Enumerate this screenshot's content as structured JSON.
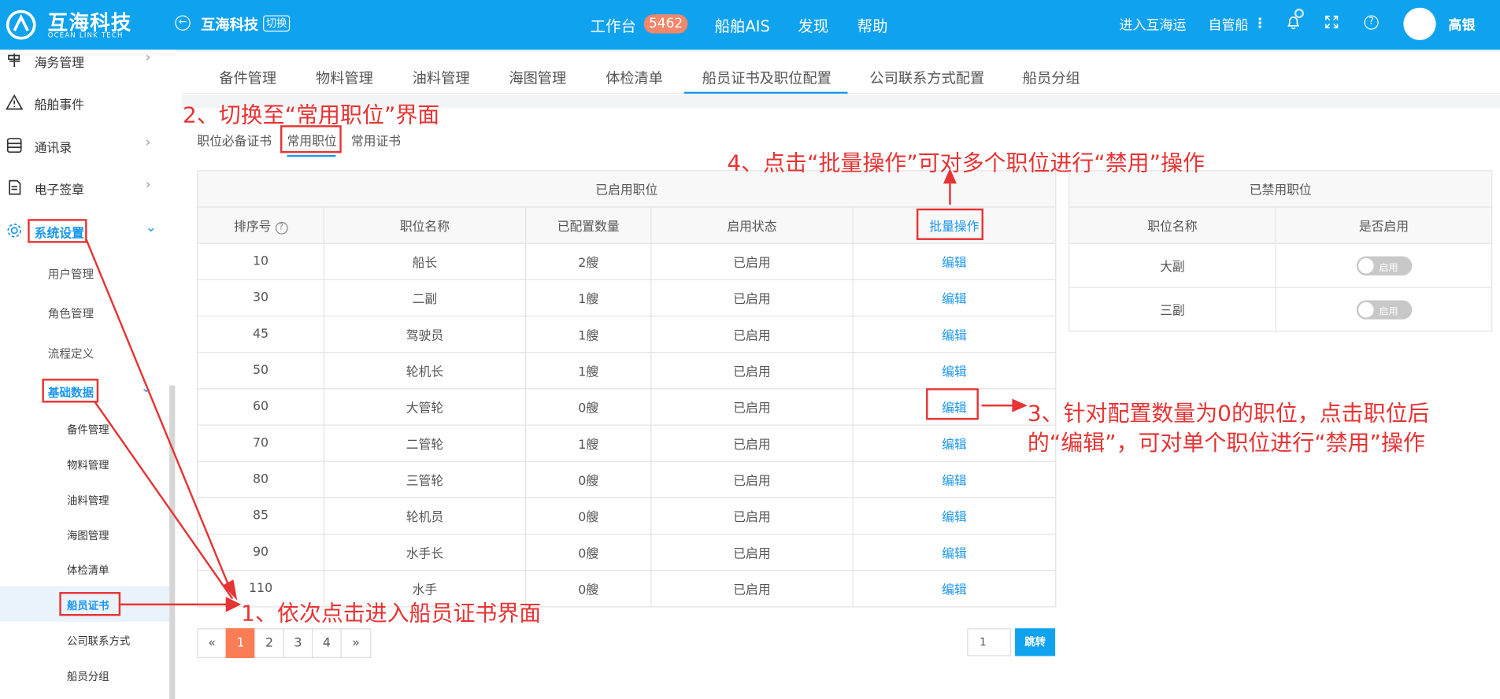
{
  "header": {
    "logo_cn": "互海科技",
    "logo_en": "OCEAN LINK TECH",
    "company": "互海科技",
    "switch_label": "切换",
    "nav": [
      "工作台",
      "船舶AIS",
      "发现",
      "帮助"
    ],
    "badge": "5462",
    "right_nav": [
      "进入互海运",
      "自管船"
    ],
    "user": "高银"
  },
  "sidebar": {
    "top_items": [
      "海务管理",
      "船舶事件",
      "通讯录",
      "电子签章",
      "系统设置"
    ],
    "settings_children": [
      "用户管理",
      "角色管理",
      "流程定义",
      "基础数据"
    ],
    "basic_children": [
      "备件管理",
      "物料管理",
      "油料管理",
      "海图管理",
      "体检清单",
      "船员证书",
      "公司联系方式",
      "船员分组"
    ]
  },
  "tabs": [
    "备件管理",
    "物料管理",
    "油料管理",
    "海图管理",
    "体检清单",
    "船员证书及职位配置",
    "公司联系方式配置",
    "船员分组"
  ],
  "subtabs": [
    "职位必备证书",
    "常用职位",
    "常用证书"
  ],
  "enabled_table": {
    "caption": "已启用职位",
    "headers": [
      "排序号",
      "职位名称",
      "已配置数量",
      "启用状态",
      "批量操作"
    ],
    "rows": [
      [
        "10",
        "船长",
        "2艘",
        "已启用",
        "编辑"
      ],
      [
        "30",
        "二副",
        "1艘",
        "已启用",
        "编辑"
      ],
      [
        "45",
        "驾驶员",
        "1艘",
        "已启用",
        "编辑"
      ],
      [
        "50",
        "轮机长",
        "1艘",
        "已启用",
        "编辑"
      ],
      [
        "60",
        "大管轮",
        "0艘",
        "已启用",
        "编辑"
      ],
      [
        "70",
        "二管轮",
        "1艘",
        "已启用",
        "编辑"
      ],
      [
        "80",
        "三管轮",
        "0艘",
        "已启用",
        "编辑"
      ],
      [
        "85",
        "轮机员",
        "0艘",
        "已启用",
        "编辑"
      ],
      [
        "90",
        "水手长",
        "0艘",
        "已启用",
        "编辑"
      ],
      [
        "110",
        "水手",
        "0艘",
        "已启用",
        "编辑"
      ]
    ]
  },
  "disabled_table": {
    "caption": "已禁用职位",
    "headers": [
      "职位名称",
      "是否启用"
    ],
    "rows": [
      {
        "name": "大副",
        "toggle": "启用"
      },
      {
        "name": "三副",
        "toggle": "启用"
      }
    ]
  },
  "pagination": {
    "prev": "«",
    "pages": [
      "1",
      "2",
      "3",
      "4"
    ],
    "current": "1",
    "next": "»",
    "jump_value": "1",
    "jump_label": "跳转"
  },
  "annotations": {
    "step1": "1、依次点击进入船员证书界面",
    "step2": "2、切换至“常用职位”界面",
    "step3_line1": "3、针对配置数量为0的职位，点击职位后",
    "step3_line2": "的“编辑”，可对单个职位进行“禁用”操作",
    "step4": "4、点击“批量操作”可对多个职位进行“禁用”操作"
  },
  "colors": {
    "header": "#0fa2ef",
    "accent": "#1c97ee",
    "annotation": "#e53434",
    "page_current": "#fa7d55",
    "badge": "#f2876a"
  }
}
